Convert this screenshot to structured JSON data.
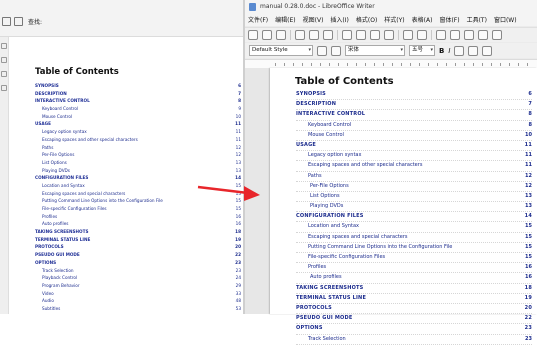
{
  "left": {
    "zoom_label": "查找:",
    "toc_title": "Table of Contents",
    "toc": [
      {
        "label": "SYNOPSIS",
        "page": "6",
        "level": "top"
      },
      {
        "label": "DESCRIPTION",
        "page": "7",
        "level": "top"
      },
      {
        "label": "INTERACTIVE CONTROL",
        "page": "8",
        "level": "top"
      },
      {
        "label": "Keyboard Control",
        "page": "9",
        "level": "sub"
      },
      {
        "label": "Mouse Control",
        "page": "10",
        "level": "sub"
      },
      {
        "label": "USAGE",
        "page": "11",
        "level": "top"
      },
      {
        "label": "Legacy option syntax",
        "page": "11",
        "level": "sub"
      },
      {
        "label": "Escaping spaces and other special characters",
        "page": "11",
        "level": "sub"
      },
      {
        "label": "Paths",
        "page": "12",
        "level": "sub"
      },
      {
        "label": "Per-File Options",
        "page": "12",
        "level": "sub"
      },
      {
        "label": "List Options",
        "page": "13",
        "level": "sub"
      },
      {
        "label": "Playing DVDs",
        "page": "13",
        "level": "sub"
      },
      {
        "label": "CONFIGURATION FILES",
        "page": "14",
        "level": "top"
      },
      {
        "label": "Location and Syntax",
        "page": "15",
        "level": "sub"
      },
      {
        "label": "Escaping spaces and special characters",
        "page": "15",
        "level": "sub"
      },
      {
        "label": "Putting Command Line Options into the Configuration File",
        "page": "15",
        "level": "sub"
      },
      {
        "label": "File-specific Configuration Files",
        "page": "15",
        "level": "sub"
      },
      {
        "label": "Profiles",
        "page": "16",
        "level": "sub"
      },
      {
        "label": "Auto profiles",
        "page": "16",
        "level": "sub"
      },
      {
        "label": "TAKING SCREENSHOTS",
        "page": "18",
        "level": "top"
      },
      {
        "label": "TERMINAL STATUS LINE",
        "page": "19",
        "level": "top"
      },
      {
        "label": "PROTOCOLS",
        "page": "20",
        "level": "top"
      },
      {
        "label": "PSEUDO GUI MODE",
        "page": "22",
        "level": "top"
      },
      {
        "label": "OPTIONS",
        "page": "23",
        "level": "top"
      },
      {
        "label": "Track Selection",
        "page": "23",
        "level": "sub"
      },
      {
        "label": "Playback Control",
        "page": "24",
        "level": "sub"
      },
      {
        "label": "Program Behavior",
        "page": "29",
        "level": "sub"
      },
      {
        "label": "Video",
        "page": "33",
        "level": "sub"
      },
      {
        "label": "Audio",
        "page": "48",
        "level": "sub"
      },
      {
        "label": "Subtitles",
        "page": "53",
        "level": "sub"
      }
    ]
  },
  "right": {
    "window_title": "manual 0.28.0.doc - LibreOffice Writer",
    "menu": [
      "文件(F)",
      "编辑(E)",
      "视图(V)",
      "插入(I)",
      "格式(O)",
      "样式(Y)",
      "表格(A)",
      "窗体(F)",
      "工具(T)",
      "窗口(W)"
    ],
    "paragraph_style": "Default Style",
    "font_name": "宋体",
    "font_size": "五号",
    "bold_label": "B",
    "italic_label": "I",
    "toc_title": "Table of Contents",
    "toc": [
      {
        "label": "SYNOPSIS",
        "page": "6",
        "level": "top"
      },
      {
        "label": "DESCRIPTION",
        "page": "7",
        "level": "top"
      },
      {
        "label": "INTERACTIVE CONTROL",
        "page": "8",
        "level": "top"
      },
      {
        "label": "Keyboard Control",
        "page": "8",
        "level": "sub"
      },
      {
        "label": "Mouse Control",
        "page": "10",
        "level": "sub"
      },
      {
        "label": "USAGE",
        "page": "11",
        "level": "top"
      },
      {
        "label": "Legacy option syntax",
        "page": "11",
        "level": "sub"
      },
      {
        "label": "Escaping spaces and other special characters",
        "page": "11",
        "level": "sub"
      },
      {
        "label": "Paths",
        "page": "12",
        "level": "sub"
      },
      {
        "label": "Per-File Options",
        "page": "12",
        "level": "deep"
      },
      {
        "label": "List Options",
        "page": "13",
        "level": "deep"
      },
      {
        "label": "Playing DVDs",
        "page": "13",
        "level": "deep"
      },
      {
        "label": "CONFIGURATION FILES",
        "page": "14",
        "level": "top"
      },
      {
        "label": "Location and Syntax",
        "page": "15",
        "level": "sub"
      },
      {
        "label": "Escaping spaces and special characters",
        "page": "15",
        "level": "sub"
      },
      {
        "label": "Putting Command Line Options into the Configuration File",
        "page": "15",
        "level": "sub"
      },
      {
        "label": "File-specific Configuration Files",
        "page": "15",
        "level": "sub"
      },
      {
        "label": "Profiles",
        "page": "16",
        "level": "sub"
      },
      {
        "label": "Auto profiles",
        "page": "16",
        "level": "deep"
      },
      {
        "label": "TAKING SCREENSHOTS",
        "page": "18",
        "level": "top"
      },
      {
        "label": "TERMINAL STATUS LINE",
        "page": "19",
        "level": "top"
      },
      {
        "label": "PROTOCOLS",
        "page": "20",
        "level": "top"
      },
      {
        "label": "PSEUDO GUI MODE",
        "page": "22",
        "level": "top"
      },
      {
        "label": "OPTIONS",
        "page": "23",
        "level": "top"
      },
      {
        "label": "Track Selection",
        "page": "23",
        "level": "sub"
      }
    ]
  },
  "arrow_color": "#e8262b"
}
